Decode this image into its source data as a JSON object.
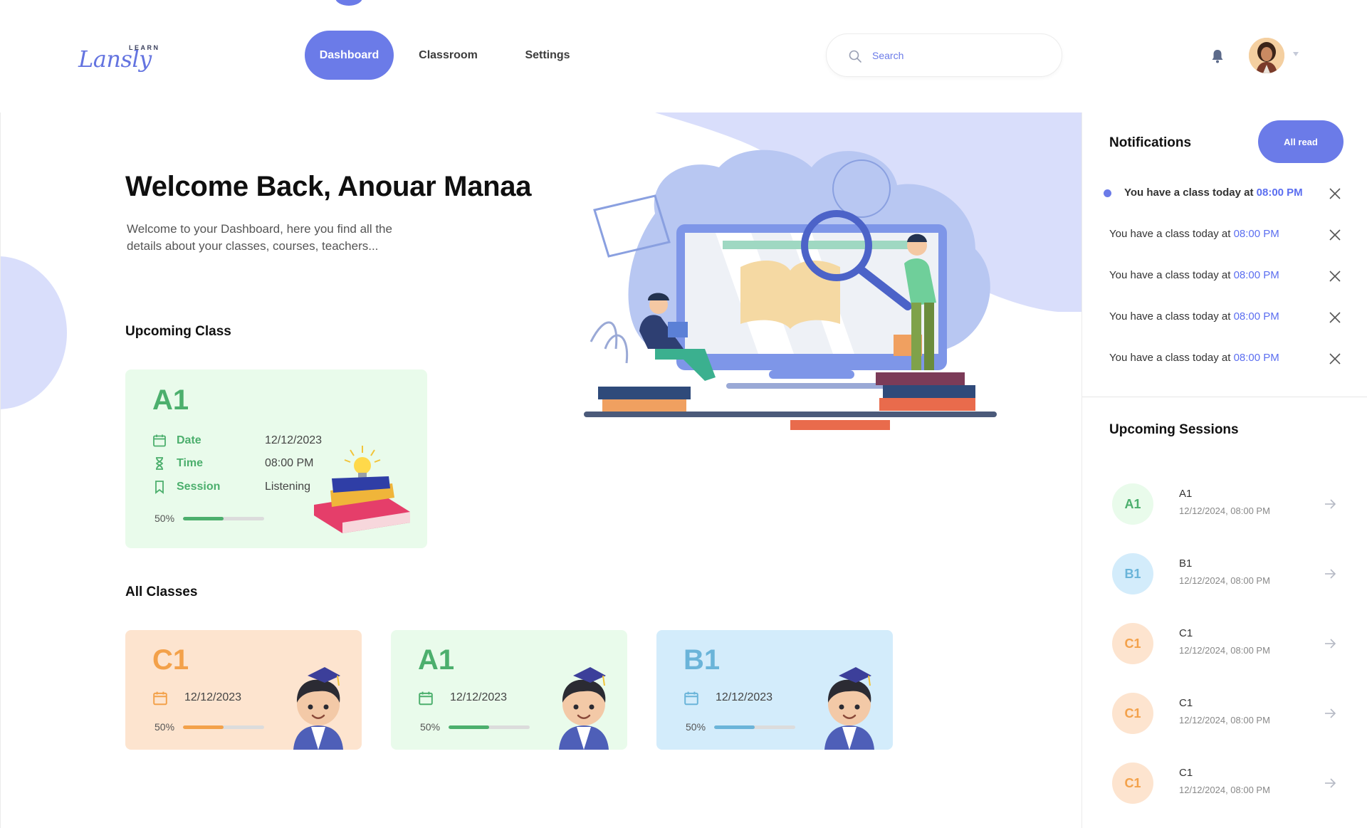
{
  "logo": {
    "name": "Lansly",
    "sub": "LEARN"
  },
  "nav": {
    "dashboard": "Dashboard",
    "classroom": "Classroom",
    "settings": "Settings"
  },
  "search": {
    "placeholder": "Search"
  },
  "icons": {
    "search": "search-icon",
    "bell": "bell-icon",
    "caret": "chevron-down-icon",
    "calendar": "calendar-icon",
    "hourglass": "hourglass-icon",
    "bookmark": "bookmark-icon",
    "close": "close-icon",
    "arrow": "arrow-right-icon"
  },
  "colors": {
    "accent": "#6b7be8",
    "green": "#4caf6d",
    "orange": "#f3a14a",
    "blue": "#6ab4d9",
    "green_bg": "#e9fbeb",
    "orange_bg": "#fde4cf",
    "blue_bg": "#d3ecfb"
  },
  "welcome": {
    "title": "Welcome Back, Anouar Manaa",
    "subtitle": "Welcome to your Dashboard, here you find all the details about your classes, courses, teachers..."
  },
  "upcoming_class": {
    "section_title": "Upcoming Class",
    "level": "A1",
    "date_label": "Date",
    "date": "12/12/2023",
    "time_label": "Time",
    "time": "08:00 PM",
    "session_label": "Session",
    "session": "Listening",
    "progress_text": "50%",
    "progress": 0.5
  },
  "all_classes": {
    "section_title": "All Classes",
    "cards": [
      {
        "level": "C1",
        "date": "12/12/2023",
        "progress_text": "50%",
        "progress": 0.5
      },
      {
        "level": "A1",
        "date": "12/12/2023",
        "progress_text": "50%",
        "progress": 0.5
      },
      {
        "level": "B1",
        "date": "12/12/2023",
        "progress_text": "50%",
        "progress": 0.5
      }
    ]
  },
  "notifications": {
    "title": "Notifications",
    "all_read": "All read",
    "items": [
      {
        "text": "You have a class today at ",
        "time": "08:00 PM",
        "unread": true
      },
      {
        "text": "You have a class today at ",
        "time": "08:00 PM",
        "unread": false
      },
      {
        "text": "You have a class today at ",
        "time": "08:00 PM",
        "unread": false
      },
      {
        "text": "You have a class today at ",
        "time": "08:00 PM",
        "unread": false
      },
      {
        "text": "You have a class today at ",
        "time": "08:00 PM",
        "unread": false
      }
    ]
  },
  "upcoming_sessions": {
    "title": "Upcoming Sessions",
    "items": [
      {
        "badge": "A1",
        "name": "A1",
        "date": "12/12/2024, 08:00 PM"
      },
      {
        "badge": "B1",
        "name": "B1",
        "date": "12/12/2024, 08:00 PM"
      },
      {
        "badge": "C1",
        "name": "C1",
        "date": "12/12/2024, 08:00 PM"
      },
      {
        "badge": "C1",
        "name": "C1",
        "date": "12/12/2024, 08:00 PM"
      },
      {
        "badge": "C1",
        "name": "C1",
        "date": "12/12/2024, 08:00 PM"
      }
    ]
  }
}
